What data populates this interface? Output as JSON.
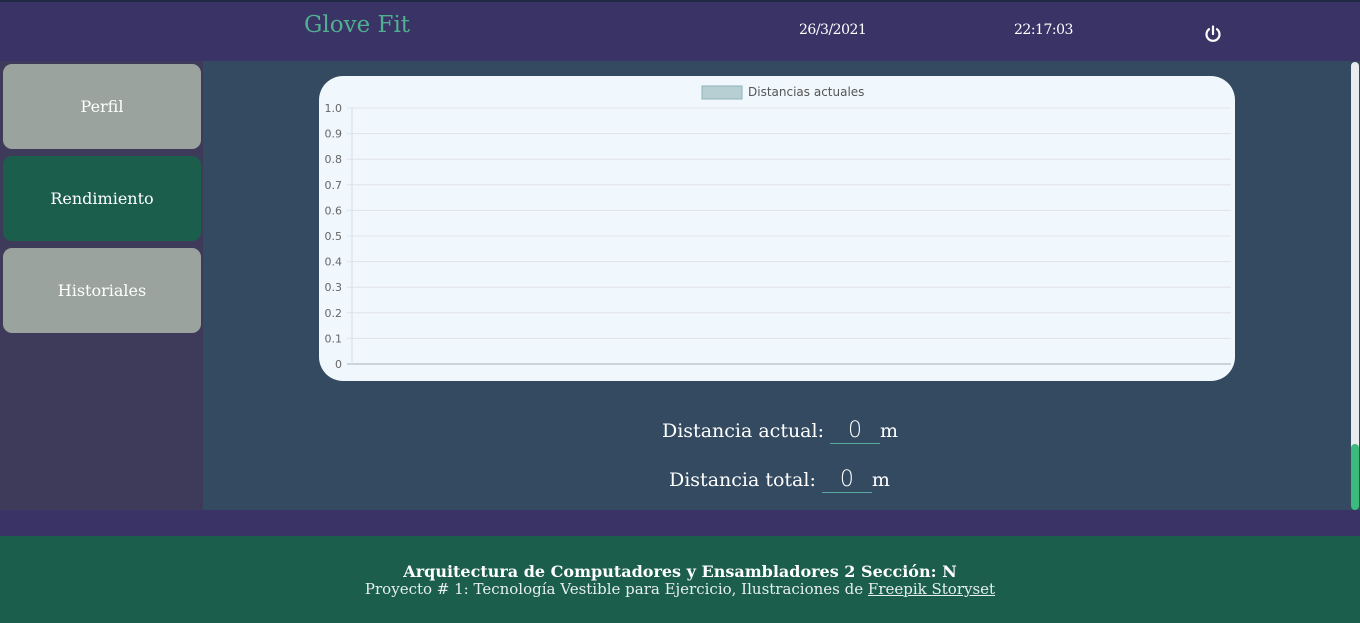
{
  "header": {
    "brand": "Glove Fit",
    "date": "26/3/2021",
    "time": "22:17:03",
    "power_icon": "power-icon"
  },
  "sidebar": {
    "items": [
      {
        "label": "Perfil",
        "active": false
      },
      {
        "label": "Rendimiento",
        "active": true
      },
      {
        "label": "Historiales",
        "active": false
      }
    ]
  },
  "chart_data": {
    "type": "bar",
    "categories": [],
    "series": [
      {
        "name": "Distancias actuales",
        "values": []
      }
    ],
    "yticks": [
      "1.0",
      "0.9",
      "0.8",
      "0.7",
      "0.6",
      "0.5",
      "0.4",
      "0.3",
      "0.2",
      "0.1",
      "0"
    ],
    "ylim": [
      0,
      1
    ],
    "grid": true,
    "legend": "top-center",
    "legend_color": "#b7cfd3"
  },
  "stats": {
    "current_label": "Distancia actual:",
    "current_value": "0",
    "current_unit": "m",
    "total_label": "Distancia total:",
    "total_value": "0",
    "total_unit": "m"
  },
  "footer": {
    "line1": "Arquitectura de Computadores y Ensambladores 2 Sección: N",
    "line2_prefix": "Proyecto # 1: Tecnología Vestible para Ejercicio, Ilustraciones de",
    "link_text": "Freepik Storyset"
  },
  "colors": {
    "header_bg": "#3a3366",
    "accent_green": "#1c5e4c",
    "brand": "#4fb08f",
    "main_bg": "#334a60"
  }
}
